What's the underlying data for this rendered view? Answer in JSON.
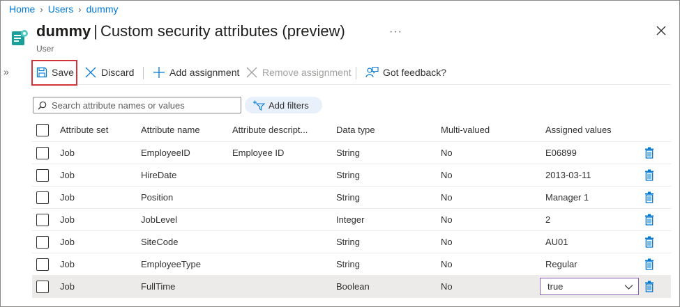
{
  "breadcrumb": [
    "Home",
    "Users",
    "dummy"
  ],
  "header": {
    "object_name": "dummy",
    "separator": "|",
    "blade_title": "Custom security attributes (preview)",
    "more": "···",
    "subtitle": "User"
  },
  "toolbar": {
    "save": "Save",
    "discard": "Discard",
    "add_assignment": "Add assignment",
    "remove_assignment": "Remove assignment",
    "feedback": "Got feedback?"
  },
  "search": {
    "placeholder": "Search attribute names or values"
  },
  "filters": {
    "add_filters": "Add filters"
  },
  "table": {
    "columns": {
      "set": "Attribute set",
      "name": "Attribute name",
      "desc": "Attribute descript...",
      "type": "Data type",
      "multi": "Multi-valued",
      "val": "Assigned values"
    },
    "rows": [
      {
        "set": "Job",
        "name": "EmployeeID",
        "desc": "Employee ID",
        "type": "String",
        "multi": "No",
        "val": "E06899"
      },
      {
        "set": "Job",
        "name": "HireDate",
        "desc": "",
        "type": "String",
        "multi": "No",
        "val": "2013-03-11"
      },
      {
        "set": "Job",
        "name": "Position",
        "desc": "",
        "type": "String",
        "multi": "No",
        "val": "Manager 1"
      },
      {
        "set": "Job",
        "name": "JobLevel",
        "desc": "",
        "type": "Integer",
        "multi": "No",
        "val": "2"
      },
      {
        "set": "Job",
        "name": "SiteCode",
        "desc": "",
        "type": "String",
        "multi": "No",
        "val": "AU01"
      },
      {
        "set": "Job",
        "name": "EmployeeType",
        "desc": "",
        "type": "String",
        "multi": "No",
        "val": "Regular"
      },
      {
        "set": "Job",
        "name": "FullTime",
        "desc": "",
        "type": "Boolean",
        "multi": "No",
        "val": "true"
      }
    ]
  },
  "colors": {
    "accent": "#0078d4",
    "highlight": "#d13438",
    "delete_icon": "#0078d4",
    "select_border": "#8764b8"
  }
}
